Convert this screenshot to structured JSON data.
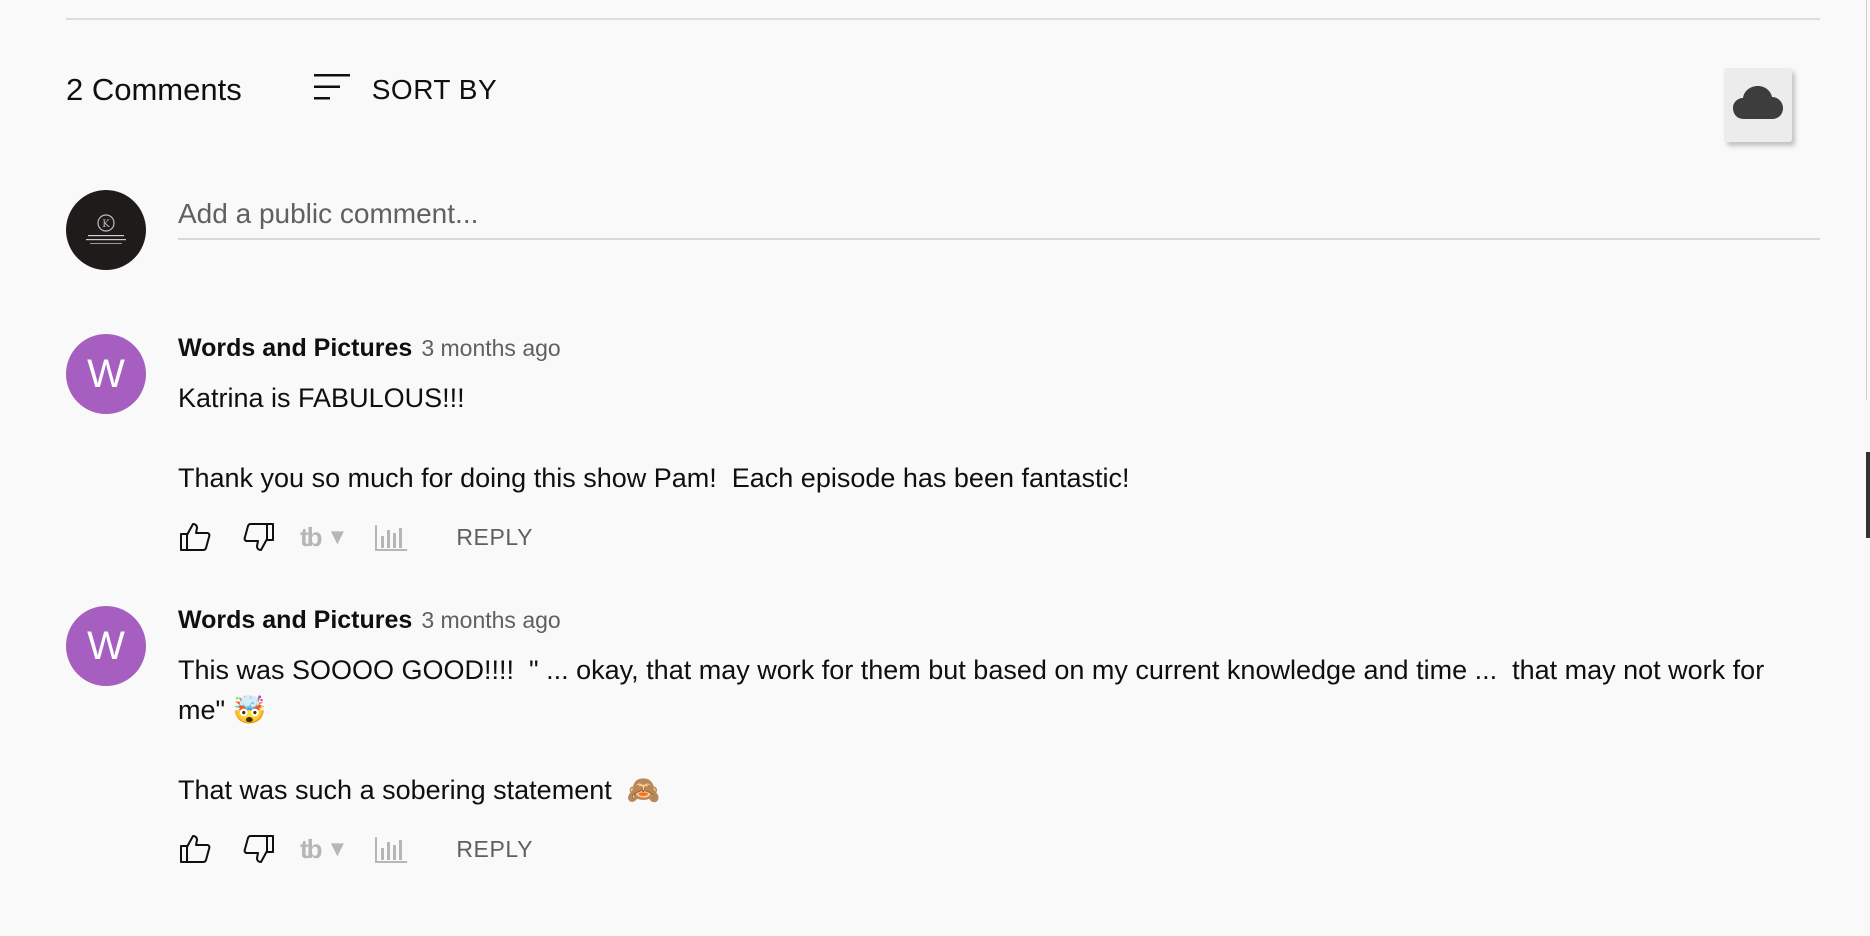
{
  "header": {
    "comments_count": "2 Comments",
    "sort_label": "SORT BY"
  },
  "composer": {
    "placeholder": "Add a public comment...",
    "avatar_text": "KATRINA YOUNG CONSULTING"
  },
  "comments": [
    {
      "avatar_letter": "W",
      "author": "Words and Pictures",
      "time": "3 months ago",
      "text": "Katrina is FABULOUS!!!\n\nThank you so much for doing this show Pam!  Each episode has been fantastic!",
      "reply_label": "REPLY",
      "tb_logo": "tb",
      "tb_arrow": "▼"
    },
    {
      "avatar_letter": "W",
      "author": "Words and Pictures",
      "time": "3 months ago",
      "text": "This was SOOOO GOOD!!!!  \" ... okay, that may work for them but based on my current knowledge and time ...  that may not work for me\" 🤯\n\nThat was such a sobering statement  🙈",
      "reply_label": "REPLY",
      "tb_logo": "tb",
      "tb_arrow": "▼"
    }
  ],
  "colors": {
    "background": "#f9f9f9",
    "avatar_purple": "#a65ec0",
    "secondary_text": "#606060"
  },
  "icons": [
    "sort-icon",
    "cloud-icon",
    "thumbs-up-icon",
    "thumbs-down-icon",
    "stats-icon"
  ]
}
